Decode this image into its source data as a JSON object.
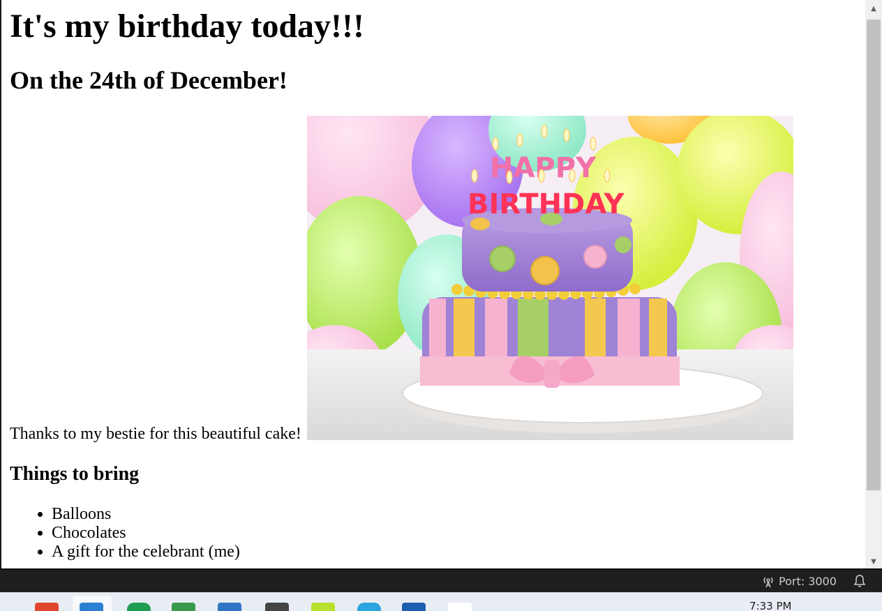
{
  "page": {
    "heading": "It's my birthday today!!!",
    "subheading": "On the 24th of December!",
    "caption": "Thanks to my bestie for this beautiful cake!",
    "cake_image_text": {
      "line1": "HAPPY",
      "line2": "BIRTHDAY"
    },
    "list_heading": "Things to bring",
    "items": [
      "Balloons",
      "Chocolates",
      "A gift for the celebrant (me)"
    ]
  },
  "statusbar": {
    "port_label": "Port: 3000",
    "port_icon": "broadcast-icon",
    "notification_icon": "bell-icon"
  },
  "taskbar": {
    "clock": "7:33 PM"
  },
  "colors": {
    "statusbar_bg": "#1f1f1f",
    "scroll_thumb": "#c1c1c1",
    "cake_purple": "#9b7fcf",
    "cake_pink": "#f5b8d0"
  }
}
